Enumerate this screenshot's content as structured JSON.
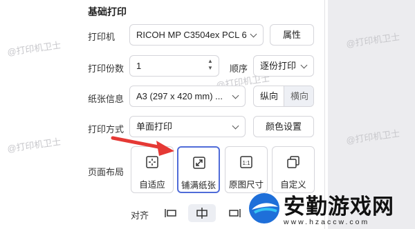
{
  "section_title": "基础打印",
  "printer": {
    "label": "打印机",
    "value": "RICOH MP C3504ex PCL 6",
    "properties_button": "属性"
  },
  "copies": {
    "label": "打印份数",
    "value": "1",
    "order_label": "顺序",
    "order_value": "逐份打印"
  },
  "paper": {
    "label": "纸张信息",
    "value": "A3 (297 x 420 mm) ...",
    "portrait": "纵向",
    "landscape": "横向"
  },
  "mode": {
    "label": "打印方式",
    "value": "单面打印",
    "color_settings_button": "颜色设置"
  },
  "layout": {
    "label": "页面布局",
    "options": [
      "自适应",
      "铺满纸张",
      "原图尺寸",
      "自定义"
    ],
    "selected": "铺满纸张"
  },
  "align": {
    "label": "对齐",
    "selected": "center"
  },
  "watermark": "@打印机卫士",
  "brand": {
    "name": "安勤游戏网",
    "url": "www.hzaccw.com"
  },
  "colors": {
    "accent": "#4f6bd8",
    "arrow": "#e53935"
  }
}
